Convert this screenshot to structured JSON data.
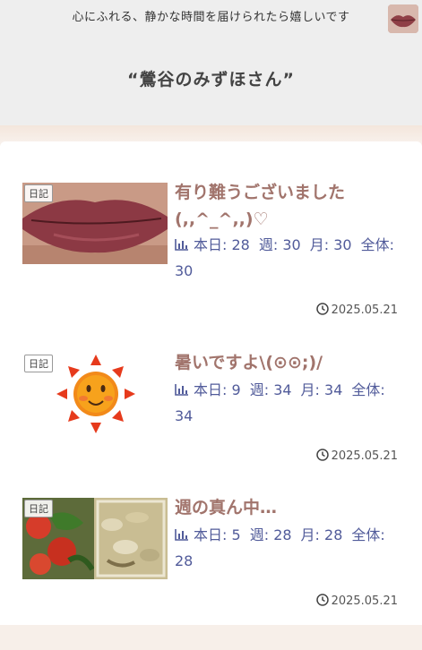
{
  "header": {
    "tagline": "心にふれる、静かな時間を届けられたら嬉しいです",
    "site_title": "“鶯谷のみずほさん”",
    "avatar_icon": "lips-avatar-icon"
  },
  "posts": [
    {
      "category": "日記",
      "title": "有り難うございました(,,^_^,,)♡",
      "stats": {
        "today_label": "本日:",
        "today": "28",
        "week_label": "週:",
        "week": "30",
        "month_label": "月:",
        "month": "30",
        "total_label": "全体:",
        "total": "30"
      },
      "date": "2025.05.21",
      "thumb": "lips-photo"
    },
    {
      "category": "日記",
      "title": "暑いですよ\\(⊙⊙;)/",
      "stats": {
        "today_label": "本日:",
        "today": "9",
        "week_label": "週:",
        "week": "34",
        "month_label": "月:",
        "month": "34",
        "total_label": "全体:",
        "total": "34"
      },
      "date": "2025.05.21",
      "thumb": "sun-illustration"
    },
    {
      "category": "日記",
      "title": "週の真ん中…",
      "stats": {
        "today_label": "本日:",
        "today": "5",
        "week_label": "週:",
        "week": "28",
        "month_label": "月:",
        "month": "28",
        "total_label": "全体:",
        "total": "28"
      },
      "date": "2025.05.21",
      "thumb": "bento-photo"
    }
  ],
  "colors": {
    "title": "#a1746c",
    "stats": "#515b9a",
    "header_bg": "#eeeeee"
  }
}
